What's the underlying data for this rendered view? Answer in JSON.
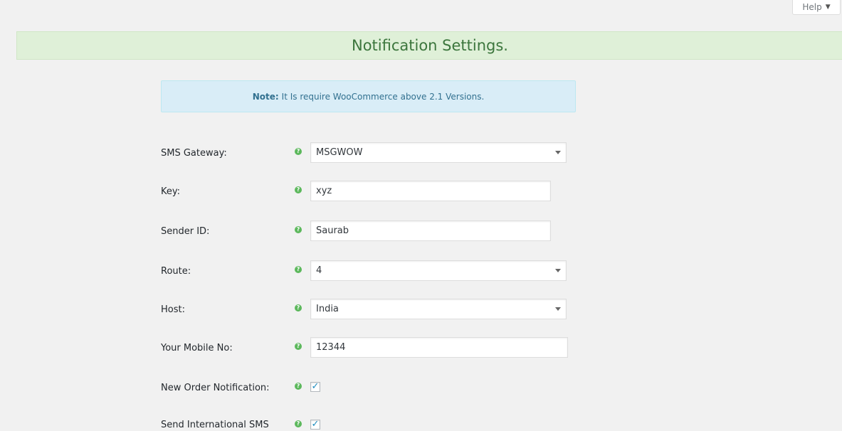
{
  "help": {
    "label": "Help",
    "caret": "▼"
  },
  "banner": {
    "title": "Notification Settings."
  },
  "note": {
    "prefix": "Note:",
    "text": "It Is require WooCommerce above 2.1 Versions."
  },
  "tip_icon": "?",
  "fields": {
    "sms_gateway": {
      "label": "SMS Gateway:",
      "value": "MSGWOW"
    },
    "key": {
      "label": "Key:",
      "value": "xyz"
    },
    "sender_id": {
      "label": "Sender ID:",
      "value": "Saurab"
    },
    "route": {
      "label": "Route:",
      "value": "4"
    },
    "host": {
      "label": "Host:",
      "value": "India"
    },
    "mobile": {
      "label": "Your Mobile No:",
      "value": "12344"
    },
    "new_order": {
      "label": "New Order Notification:",
      "checked": true,
      "mark": "✓"
    },
    "intl_sms": {
      "label": "Send International SMS",
      "checked": true,
      "mark": "✓"
    }
  },
  "colors": {
    "banner_bg": "#dff0d8",
    "banner_text": "#3c763d",
    "note_bg": "#d9edf7",
    "note_text": "#31708f",
    "tip": "#5cb85c",
    "check": "#1e8cbe"
  }
}
